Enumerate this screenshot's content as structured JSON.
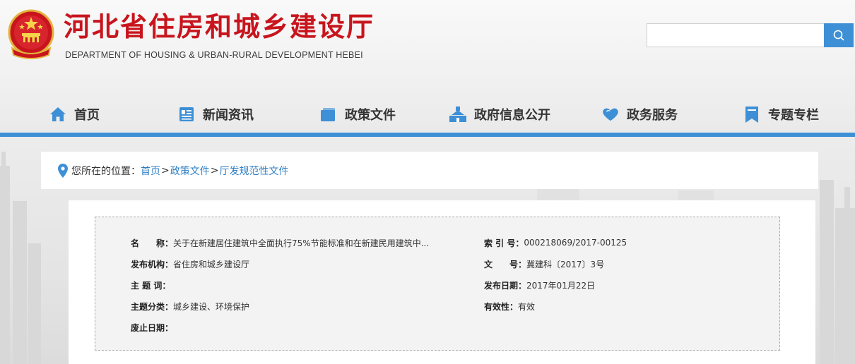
{
  "header": {
    "title": "河北省住房和城乡建设厅",
    "subtitle": "DEPARTMENT OF HOUSING & URBAN-RURAL DEVELOPMENT HEBEI",
    "search": {
      "placeholder": "",
      "button_icon": "search-icon"
    },
    "emblem_icon": "national-emblem-icon"
  },
  "nav": {
    "items": [
      {
        "label": "首页",
        "icon": "home-icon"
      },
      {
        "label": "新闻资讯",
        "icon": "news-icon"
      },
      {
        "label": "政策文件",
        "icon": "folder-icon"
      },
      {
        "label": "政府信息公开",
        "icon": "building-icon"
      },
      {
        "label": "政务服务",
        "icon": "heart-icon"
      },
      {
        "label": "专题专栏",
        "icon": "bookmark-icon"
      }
    ]
  },
  "breadcrumb": {
    "prefix": "您所在的位置：",
    "items": [
      "首页",
      "政策文件",
      "厅发规范性文件"
    ],
    "separator": ">"
  },
  "doc_info": {
    "name_label": "名　　称：",
    "name_value": "关于在新建居住建筑中全面执行75%节能标准和在新建民用建筑中...",
    "index_label": "索 引 号：",
    "index_value": "000218069/2017-00125",
    "publisher_label": "发布机构：",
    "publisher_value": "省住房和城乡建设厅",
    "docno_label": "文　　号：",
    "docno_value": "冀建科〔2017〕3号",
    "keywords_label": "主 题 词：",
    "keywords_value": "",
    "date_label": "发布日期：",
    "date_value": "2017年01月22日",
    "category_label": "主题分类：",
    "category_value": "城乡建设、环境保护",
    "validity_label": "有效性：",
    "validity_value": "有效",
    "expire_label": "废止日期：",
    "expire_value": ""
  },
  "colors": {
    "brand_red": "#c8151d",
    "accent_blue": "#3d8fd6",
    "link_blue": "#2f7fc4"
  }
}
